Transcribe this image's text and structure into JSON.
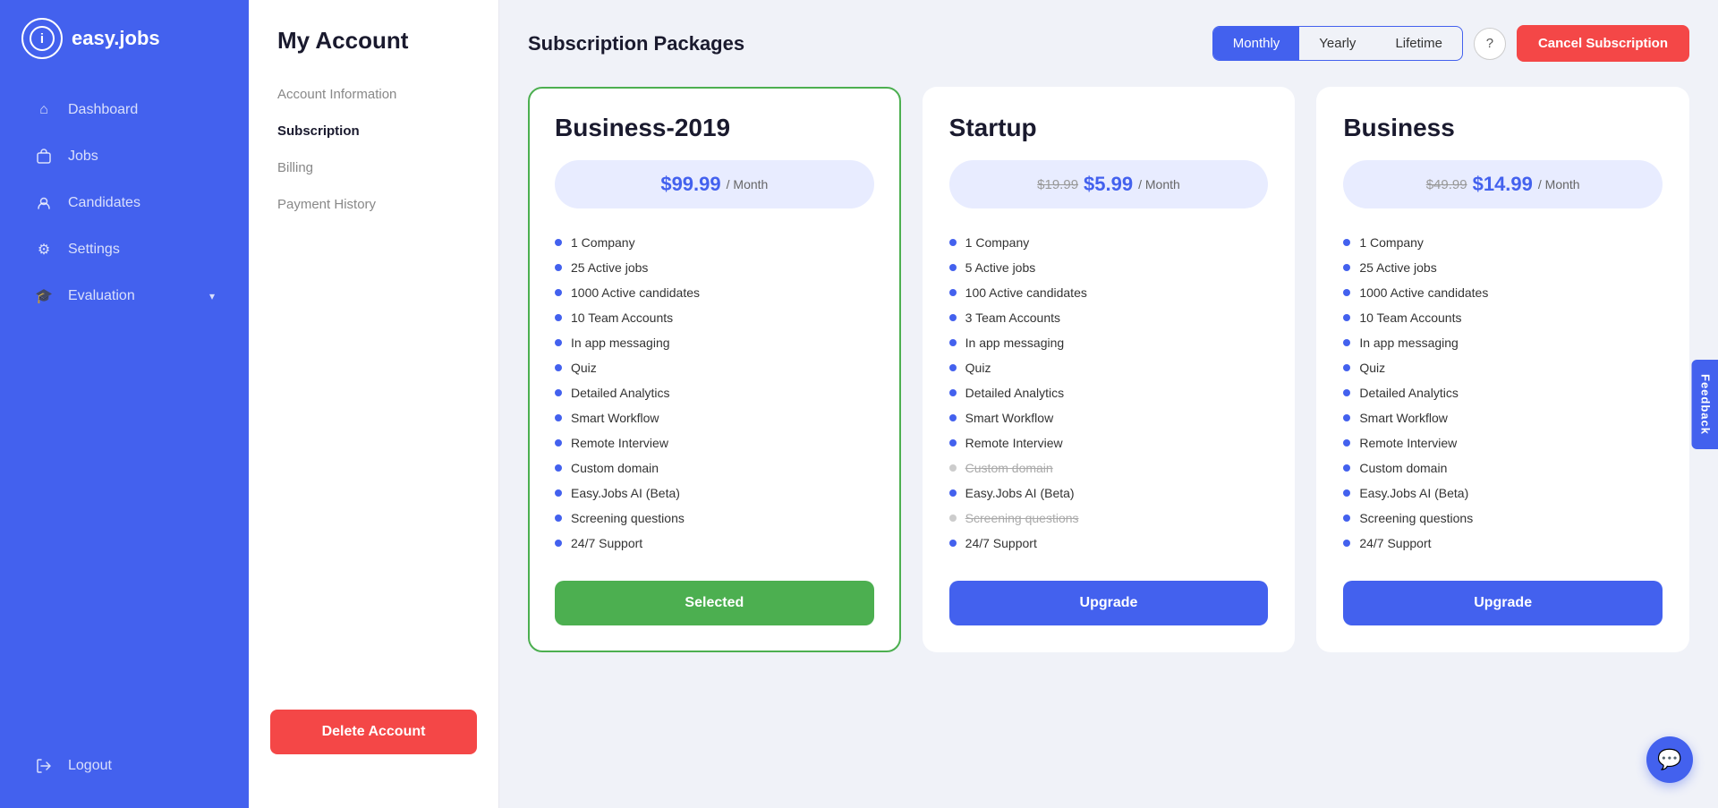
{
  "app": {
    "name": "easy.jobs",
    "logo_letter": "i"
  },
  "sidebar": {
    "items": [
      {
        "id": "dashboard",
        "label": "Dashboard",
        "icon": "⌂",
        "active": false
      },
      {
        "id": "jobs",
        "label": "Jobs",
        "icon": "💼",
        "active": false
      },
      {
        "id": "candidates",
        "label": "Candidates",
        "icon": "👤",
        "active": false
      },
      {
        "id": "settings",
        "label": "Settings",
        "icon": "⚙",
        "active": false
      },
      {
        "id": "evaluation",
        "label": "Evaluation",
        "icon": "🎓",
        "active": false,
        "hasArrow": true
      }
    ],
    "logout_label": "Logout"
  },
  "left_panel": {
    "title": "My Account",
    "menu": [
      {
        "id": "account-info",
        "label": "Account Information",
        "active": false
      },
      {
        "id": "subscription",
        "label": "Subscription",
        "active": true
      },
      {
        "id": "billing",
        "label": "Billing",
        "active": false
      },
      {
        "id": "payment-history",
        "label": "Payment History",
        "active": false
      }
    ],
    "delete_button": "Delete Account"
  },
  "header": {
    "title": "Subscription Packages",
    "billing_toggle": {
      "monthly": "Monthly",
      "yearly": "Yearly",
      "lifetime": "Lifetime",
      "active": "monthly"
    },
    "help_icon": "?",
    "cancel_button": "Cancel Subscription"
  },
  "plans": [
    {
      "id": "business-2019",
      "name": "Business-2019",
      "price_current": "$99.99",
      "price_original": null,
      "period": "/ Month",
      "selected": true,
      "button_label": "Selected",
      "button_type": "selected",
      "features": [
        {
          "label": "1 Company",
          "active": true
        },
        {
          "label": "25 Active jobs",
          "active": true
        },
        {
          "label": "1000 Active candidates",
          "active": true
        },
        {
          "label": "10 Team Accounts",
          "active": true
        },
        {
          "label": "In app messaging",
          "active": true
        },
        {
          "label": "Quiz",
          "active": true
        },
        {
          "label": "Detailed Analytics",
          "active": true
        },
        {
          "label": "Smart Workflow",
          "active": true
        },
        {
          "label": "Remote Interview",
          "active": true
        },
        {
          "label": "Custom domain",
          "active": true
        },
        {
          "label": "Easy.Jobs AI (Beta)",
          "active": true
        },
        {
          "label": "Screening questions",
          "active": true
        },
        {
          "label": "24/7 Support",
          "active": true
        }
      ]
    },
    {
      "id": "startup",
      "name": "Startup",
      "price_current": "$5.99",
      "price_original": "$19.99",
      "period": "/ Month",
      "selected": false,
      "button_label": "Upgrade",
      "button_type": "upgrade",
      "features": [
        {
          "label": "1 Company",
          "active": true
        },
        {
          "label": "5 Active jobs",
          "active": true
        },
        {
          "label": "100 Active candidates",
          "active": true
        },
        {
          "label": "3 Team Accounts",
          "active": true
        },
        {
          "label": "In app messaging",
          "active": true
        },
        {
          "label": "Quiz",
          "active": true
        },
        {
          "label": "Detailed Analytics",
          "active": true
        },
        {
          "label": "Smart Workflow",
          "active": true
        },
        {
          "label": "Remote Interview",
          "active": true
        },
        {
          "label": "Custom domain",
          "active": false
        },
        {
          "label": "Easy.Jobs AI (Beta)",
          "active": true
        },
        {
          "label": "Screening questions",
          "active": false
        },
        {
          "label": "24/7 Support",
          "active": true
        }
      ]
    },
    {
      "id": "business",
      "name": "Business",
      "price_current": "$14.99",
      "price_original": "$49.99",
      "period": "/ Month",
      "selected": false,
      "button_label": "Upgrade",
      "button_type": "upgrade",
      "features": [
        {
          "label": "1 Company",
          "active": true
        },
        {
          "label": "25 Active jobs",
          "active": true
        },
        {
          "label": "1000 Active candidates",
          "active": true
        },
        {
          "label": "10 Team Accounts",
          "active": true
        },
        {
          "label": "In app messaging",
          "active": true
        },
        {
          "label": "Quiz",
          "active": true
        },
        {
          "label": "Detailed Analytics",
          "active": true
        },
        {
          "label": "Smart Workflow",
          "active": true
        },
        {
          "label": "Remote Interview",
          "active": true
        },
        {
          "label": "Custom domain",
          "active": true
        },
        {
          "label": "Easy.Jobs AI (Beta)",
          "active": true
        },
        {
          "label": "Screening questions",
          "active": true
        },
        {
          "label": "24/7 Support",
          "active": true
        }
      ]
    }
  ],
  "feedback": {
    "label": "Feedback"
  },
  "chat": {
    "icon": "💬"
  }
}
